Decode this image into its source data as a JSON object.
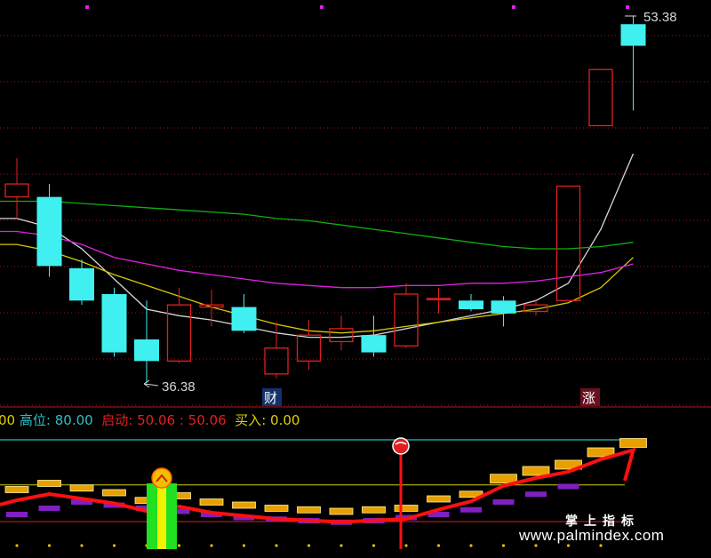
{
  "upper_panel": {
    "high_label": "53.38",
    "low_label": "36.38",
    "badge_cai": "财",
    "badge_zhang": "涨",
    "colors": {
      "up": "#e02020",
      "down": "#40f0f0",
      "ma_white": "#d8d8d8",
      "ma_yellow": "#d8c800",
      "ma_magenta": "#e020e0",
      "ma_green": "#10b010",
      "grid": "#8b1a1a"
    }
  },
  "indicator_panel": {
    "leading_fragment": "00",
    "high_label": "高位",
    "high_value": "80.00",
    "start_label": "启动",
    "start_value_1": "50.06",
    "start_value_2": "50.06",
    "buy_label": "买入",
    "buy_value": "0.00",
    "sep": ":",
    "colors": {
      "high": "#30c0c0",
      "start": "#e02020",
      "buy": "#e0d000",
      "line80": "#20c0c0",
      "line50": "#d0d000",
      "line20": "#e02020"
    }
  },
  "watermark": {
    "line1": "掌上指标",
    "line2": "www.palmindex.com"
  },
  "chart_data": [
    {
      "type": "candlestick",
      "series": [
        {
          "values": [
            {
              "o": 45.0,
              "c": 45.6,
              "h": 46.8,
              "l": 44.0
            },
            {
              "o": 45.0,
              "c": 41.8,
              "h": 45.6,
              "l": 41.3
            },
            {
              "o": 41.7,
              "c": 40.2,
              "h": 42.1,
              "l": 40.0
            },
            {
              "o": 40.5,
              "c": 37.8,
              "h": 40.8,
              "l": 37.6
            },
            {
              "o": 38.4,
              "c": 37.4,
              "h": 40.2,
              "l": 36.38
            },
            {
              "o": 37.4,
              "c": 40.0,
              "h": 40.8,
              "l": 37.3
            },
            {
              "o": 39.9,
              "c": 40.0,
              "h": 40.7,
              "l": 39.0
            },
            {
              "o": 39.9,
              "c": 38.8,
              "h": 40.5,
              "l": 38.7
            },
            {
              "o": 36.8,
              "c": 38.0,
              "h": 39.2,
              "l": 36.6
            },
            {
              "o": 37.4,
              "c": 38.6,
              "h": 39.3,
              "l": 37.0
            },
            {
              "o": 38.3,
              "c": 38.9,
              "h": 39.5,
              "l": 37.9
            },
            {
              "o": 38.6,
              "c": 37.8,
              "h": 39.5,
              "l": 37.6
            },
            {
              "o": 38.1,
              "c": 40.5,
              "h": 41.0,
              "l": 38.0
            },
            {
              "o": 40.3,
              "c": 40.3,
              "h": 40.8,
              "l": 39.6
            },
            {
              "o": 40.2,
              "c": 39.8,
              "h": 40.5,
              "l": 39.7
            },
            {
              "o": 40.2,
              "c": 39.6,
              "h": 40.4,
              "l": 39.0
            },
            {
              "o": 39.7,
              "c": 40.0,
              "h": 40.2,
              "l": 39.5
            },
            {
              "o": 40.2,
              "c": 45.5,
              "h": 45.5,
              "l": 40.2
            },
            {
              "o": 48.3,
              "c": 50.9,
              "h": 50.9,
              "l": 48.3
            },
            {
              "o": 53.0,
              "c": 52.0,
              "h": 53.38,
              "l": 49.0
            }
          ]
        }
      ]
    },
    {
      "type": "line",
      "series": [
        {
          "values": [
            {
              "x": 0,
              "y": 44.0
            },
            {
              "x": 1,
              "y": 43.6
            },
            {
              "x": 2,
              "y": 42.6
            },
            {
              "x": 3,
              "y": 41.2
            },
            {
              "x": 4,
              "y": 39.8
            },
            {
              "x": 5,
              "y": 39.5
            },
            {
              "x": 6,
              "y": 39.3
            },
            {
              "x": 7,
              "y": 39.0
            },
            {
              "x": 8,
              "y": 38.7
            },
            {
              "x": 9,
              "y": 38.5
            },
            {
              "x": 10,
              "y": 38.5
            },
            {
              "x": 11,
              "y": 38.6
            },
            {
              "x": 12,
              "y": 38.9
            },
            {
              "x": 13,
              "y": 39.2
            },
            {
              "x": 14,
              "y": 39.5
            },
            {
              "x": 15,
              "y": 39.8
            },
            {
              "x": 16,
              "y": 40.2
            },
            {
              "x": 17,
              "y": 41.0
            },
            {
              "x": 18,
              "y": 43.5
            },
            {
              "x": 19,
              "y": 47.0
            }
          ]
        },
        {
          "values": [
            {
              "x": 0,
              "y": 42.8
            },
            {
              "x": 1,
              "y": 42.5
            },
            {
              "x": 2,
              "y": 42.0
            },
            {
              "x": 3,
              "y": 41.4
            },
            {
              "x": 4,
              "y": 40.9
            },
            {
              "x": 5,
              "y": 40.4
            },
            {
              "x": 6,
              "y": 39.9
            },
            {
              "x": 7,
              "y": 39.5
            },
            {
              "x": 8,
              "y": 39.1
            },
            {
              "x": 9,
              "y": 38.8
            },
            {
              "x": 10,
              "y": 38.7
            },
            {
              "x": 11,
              "y": 38.8
            },
            {
              "x": 12,
              "y": 39.0
            },
            {
              "x": 13,
              "y": 39.2
            },
            {
              "x": 14,
              "y": 39.4
            },
            {
              "x": 15,
              "y": 39.6
            },
            {
              "x": 16,
              "y": 39.8
            },
            {
              "x": 17,
              "y": 40.1
            },
            {
              "x": 18,
              "y": 40.8
            },
            {
              "x": 19,
              "y": 42.2
            }
          ]
        },
        {
          "values": [
            {
              "x": 0,
              "y": 43.4
            },
            {
              "x": 1,
              "y": 43.2
            },
            {
              "x": 2,
              "y": 42.8
            },
            {
              "x": 3,
              "y": 42.2
            },
            {
              "x": 4,
              "y": 41.9
            },
            {
              "x": 5,
              "y": 41.6
            },
            {
              "x": 6,
              "y": 41.4
            },
            {
              "x": 7,
              "y": 41.2
            },
            {
              "x": 8,
              "y": 41.0
            },
            {
              "x": 9,
              "y": 40.9
            },
            {
              "x": 10,
              "y": 40.8
            },
            {
              "x": 11,
              "y": 40.8
            },
            {
              "x": 12,
              "y": 40.9
            },
            {
              "x": 13,
              "y": 40.9
            },
            {
              "x": 14,
              "y": 41.0
            },
            {
              "x": 15,
              "y": 41.0
            },
            {
              "x": 16,
              "y": 41.1
            },
            {
              "x": 17,
              "y": 41.3
            },
            {
              "x": 18,
              "y": 41.5
            },
            {
              "x": 19,
              "y": 41.9
            }
          ]
        },
        {
          "values": [
            {
              "x": 0,
              "y": 44.8
            },
            {
              "x": 1,
              "y": 44.8
            },
            {
              "x": 2,
              "y": 44.7
            },
            {
              "x": 3,
              "y": 44.6
            },
            {
              "x": 4,
              "y": 44.5
            },
            {
              "x": 5,
              "y": 44.4
            },
            {
              "x": 6,
              "y": 44.3
            },
            {
              "x": 7,
              "y": 44.2
            },
            {
              "x": 8,
              "y": 44.0
            },
            {
              "x": 9,
              "y": 43.9
            },
            {
              "x": 10,
              "y": 43.7
            },
            {
              "x": 11,
              "y": 43.5
            },
            {
              "x": 12,
              "y": 43.3
            },
            {
              "x": 13,
              "y": 43.1
            },
            {
              "x": 14,
              "y": 42.9
            },
            {
              "x": 15,
              "y": 42.7
            },
            {
              "x": 16,
              "y": 42.6
            },
            {
              "x": 17,
              "y": 42.6
            },
            {
              "x": 18,
              "y": 42.7
            },
            {
              "x": 19,
              "y": 42.9
            }
          ]
        }
      ]
    },
    {
      "type": "bar",
      "ylim": [
        0,
        100
      ],
      "series": [
        {
          "values": [
            {
              "x": 0,
              "y": 48
            },
            {
              "x": 1,
              "y": 52
            },
            {
              "x": 2,
              "y": 49
            },
            {
              "x": 3,
              "y": 46
            },
            {
              "x": 4,
              "y": 41
            },
            {
              "x": 5,
              "y": 44
            },
            {
              "x": 6,
              "y": 40
            },
            {
              "x": 7,
              "y": 38
            },
            {
              "x": 8,
              "y": 36
            },
            {
              "x": 9,
              "y": 35
            },
            {
              "x": 10,
              "y": 34
            },
            {
              "x": 11,
              "y": 35
            },
            {
              "x": 12,
              "y": 36
            },
            {
              "x": 13,
              "y": 42
            },
            {
              "x": 14,
              "y": 45
            },
            {
              "x": 15,
              "y": 55
            },
            {
              "x": 16,
              "y": 60
            },
            {
              "x": 17,
              "y": 64
            },
            {
              "x": 18,
              "y": 72
            },
            {
              "x": 19,
              "y": 78
            }
          ]
        },
        {
          "values": [
            {
              "x": 0,
              "y": 32
            },
            {
              "x": 1,
              "y": 36
            },
            {
              "x": 2,
              "y": 40
            },
            {
              "x": 3,
              "y": 38
            },
            {
              "x": 4,
              "y": 36
            },
            {
              "x": 5,
              "y": 34
            },
            {
              "x": 6,
              "y": 32
            },
            {
              "x": 7,
              "y": 30
            },
            {
              "x": 8,
              "y": 29
            },
            {
              "x": 9,
              "y": 28
            },
            {
              "x": 10,
              "y": 27
            },
            {
              "x": 11,
              "y": 28
            },
            {
              "x": 12,
              "y": 30
            },
            {
              "x": 13,
              "y": 32
            },
            {
              "x": 14,
              "y": 35
            },
            {
              "x": 15,
              "y": 40
            },
            {
              "x": 16,
              "y": 45
            },
            {
              "x": 17,
              "y": 50
            }
          ]
        },
        {
          "values": [
            {
              "x": 4,
              "y": 48
            },
            {
              "x": 12,
              "y": 45
            }
          ]
        }
      ]
    }
  ]
}
